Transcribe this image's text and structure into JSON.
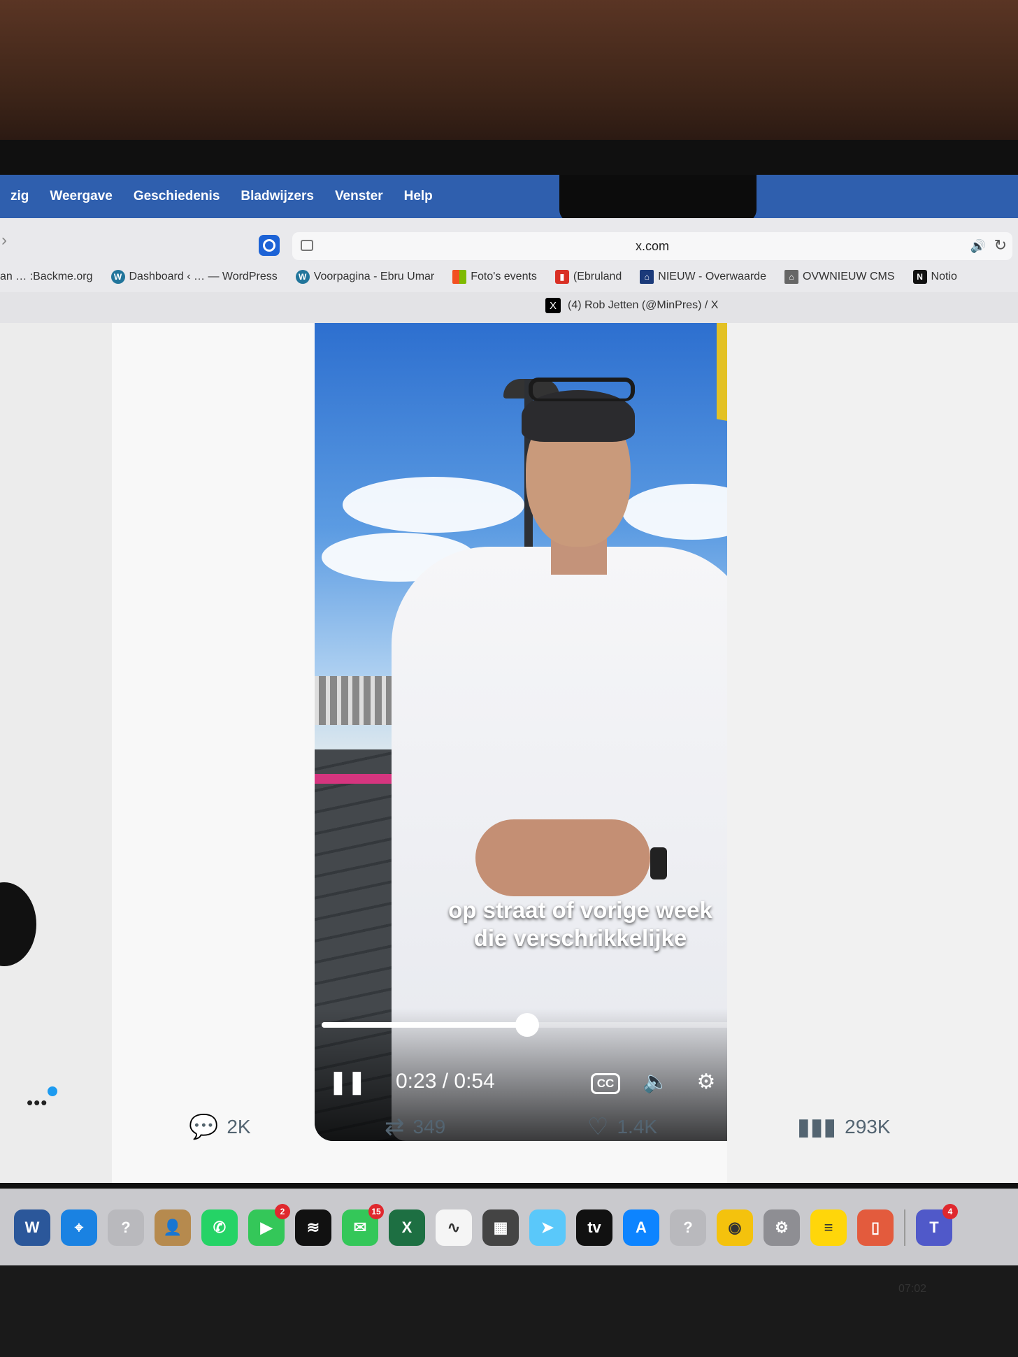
{
  "menubar": {
    "items": [
      "zig",
      "Weergave",
      "Geschiedenis",
      "Bladwijzers",
      "Venster",
      "Help"
    ]
  },
  "browser": {
    "url": "x.com",
    "bookmarks": [
      {
        "label": "an … :Backme.org",
        "icon": "text",
        "color": "#888888"
      },
      {
        "label": "Dashboard ‹ … — WordPress",
        "icon": "wordpress-icon",
        "color": "#21759b"
      },
      {
        "label": "Voorpagina - Ebru Umar",
        "icon": "wordpress-icon",
        "color": "#21759b"
      },
      {
        "label": "Foto's events",
        "icon": "windows-icon",
        "color": "#f25022"
      },
      {
        "label": "(Ebruland",
        "icon": "bookmark-icon",
        "color": "#d93025"
      },
      {
        "label": "NIEUW - Overwaarde",
        "icon": "overwaarde-icon",
        "color": "#1b3a7a"
      },
      {
        "label": "OVWNIEUW CMS",
        "icon": "overwaarde-icon",
        "color": "#666666"
      },
      {
        "label": "Notio",
        "icon": "notion-icon",
        "color": "#111111"
      }
    ],
    "tab": {
      "title": "(4) Rob Jetten (@MinPres) / X",
      "icon": "x-logo-icon"
    }
  },
  "video": {
    "subtitle_line1": "op straat of vorige week",
    "subtitle_line2": "die verschrikkelijke",
    "time": "0:23 / 0:54",
    "progress": 0.426,
    "cc_label": "CC"
  },
  "actions": {
    "replies": "2K",
    "reposts": "349",
    "likes": "1.4K",
    "views": "293K"
  },
  "dock": {
    "apps": [
      {
        "name": "word",
        "label": "W",
        "color": "#2b579a",
        "badge": ""
      },
      {
        "name": "safari",
        "label": "⌖",
        "color": "#1a82e2",
        "badge": ""
      },
      {
        "name": "unknown",
        "label": "?",
        "color": "#b9b9bd",
        "badge": ""
      },
      {
        "name": "contacts",
        "label": "👤",
        "color": "#b68a4e",
        "badge": ""
      },
      {
        "name": "whatsapp",
        "label": "✆",
        "color": "#25d366",
        "badge": ""
      },
      {
        "name": "facetime",
        "label": "▶",
        "color": "#34c759",
        "badge": "2"
      },
      {
        "name": "spotify",
        "label": "≋",
        "color": "#111111",
        "badge": ""
      },
      {
        "name": "messages",
        "label": "✉",
        "color": "#34c759",
        "badge": "15"
      },
      {
        "name": "excel",
        "label": "X",
        "color": "#1d6f42",
        "badge": ""
      },
      {
        "name": "freeform",
        "label": "∿",
        "color": "#f5f5f5",
        "badge": ""
      },
      {
        "name": "calculator",
        "label": "▦",
        "color": "#444444",
        "badge": ""
      },
      {
        "name": "maps",
        "label": "➤",
        "color": "#5ac8fa",
        "badge": ""
      },
      {
        "name": "apple-tv",
        "label": "tv",
        "color": "#111111",
        "badge": ""
      },
      {
        "name": "app-store",
        "label": "A",
        "color": "#0d84ff",
        "badge": ""
      },
      {
        "name": "unknown-2",
        "label": "?",
        "color": "#b9b9bd",
        "badge": ""
      },
      {
        "name": "chrome",
        "label": "◉",
        "color": "#f4c20d",
        "badge": ""
      },
      {
        "name": "system-settings",
        "label": "⚙",
        "color": "#8e8e93",
        "badge": ""
      },
      {
        "name": "notes",
        "label": "≡",
        "color": "#ffd60a",
        "badge": ""
      },
      {
        "name": "iphone-mirroring",
        "label": "▯",
        "color": "#e35b3d",
        "badge": ""
      },
      {
        "name": "teams",
        "label": "T",
        "color": "#5059c9",
        "badge": "4"
      }
    ]
  },
  "clock": "07:02"
}
